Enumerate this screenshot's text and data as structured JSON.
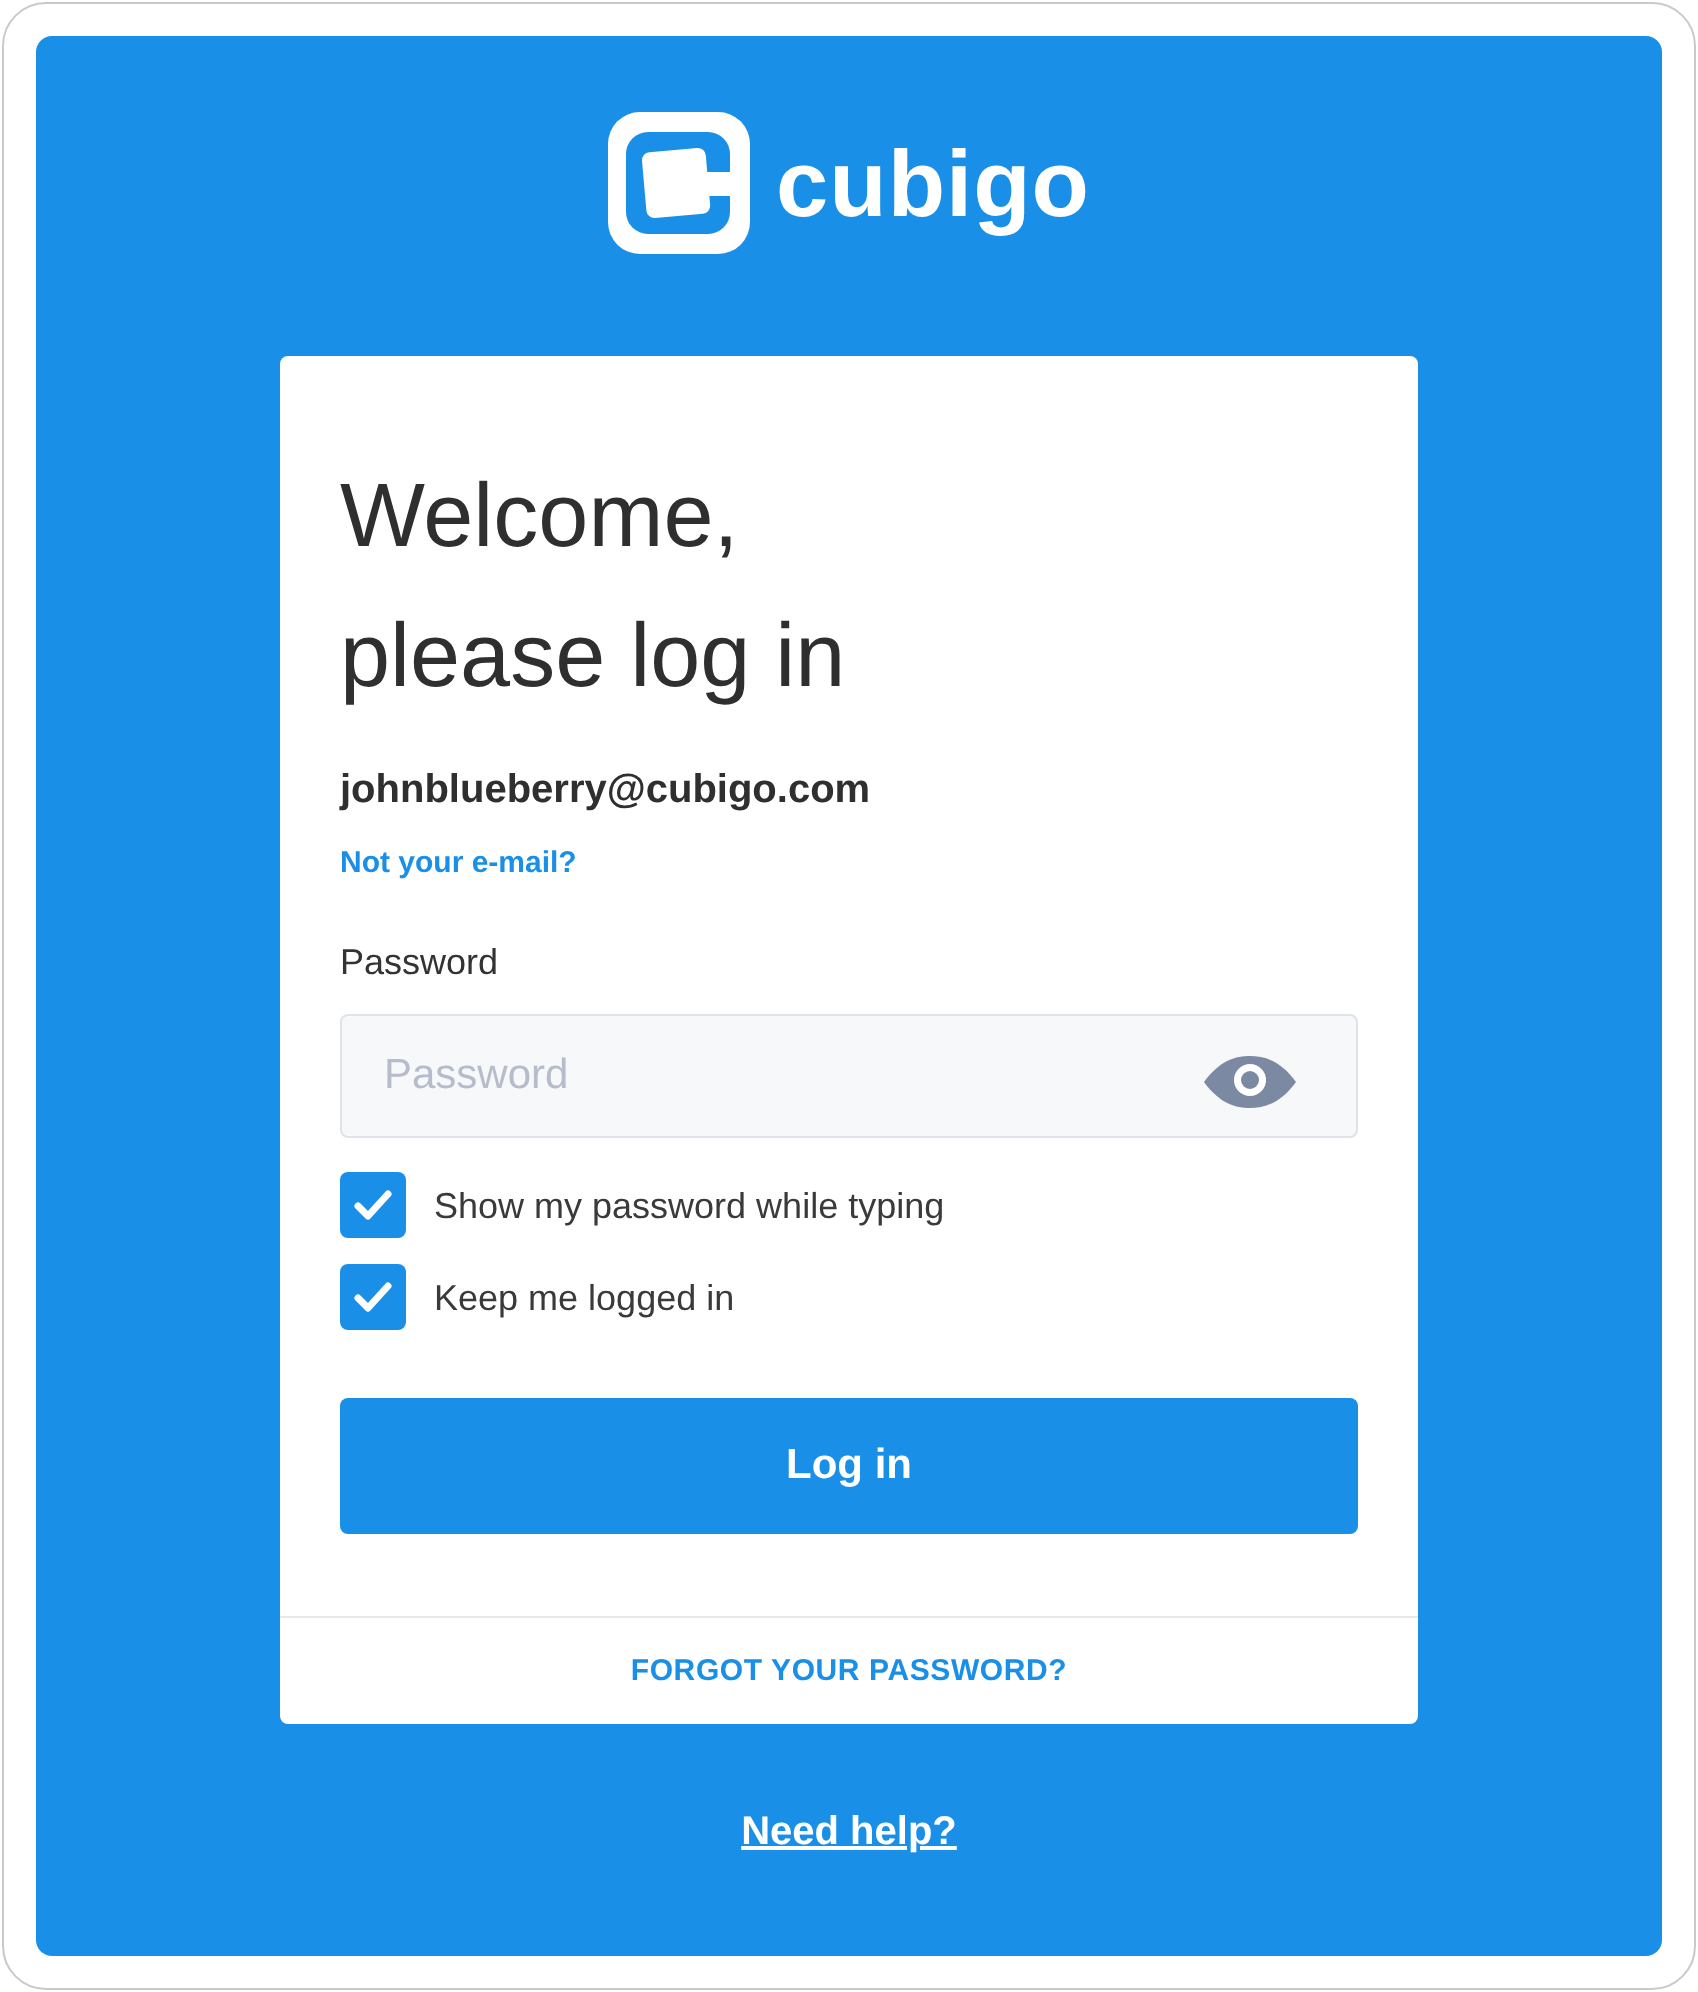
{
  "logo": {
    "text": "cubigo"
  },
  "card": {
    "heading_lines": [
      "Welcome,",
      "please log in"
    ],
    "email": "johnblueberry@cubigo.com",
    "change_email_link": "Not your e-mail?",
    "password_field": {
      "label": "Password",
      "placeholder": "Password"
    },
    "options": [
      {
        "label": "Show my password while typing",
        "checked": true
      },
      {
        "label": "Keep me logged in",
        "checked": true
      }
    ],
    "login_button": "Log in",
    "forgot_link": "FORGOT YOUR PASSWORD?"
  },
  "help_link": "Need help?"
}
